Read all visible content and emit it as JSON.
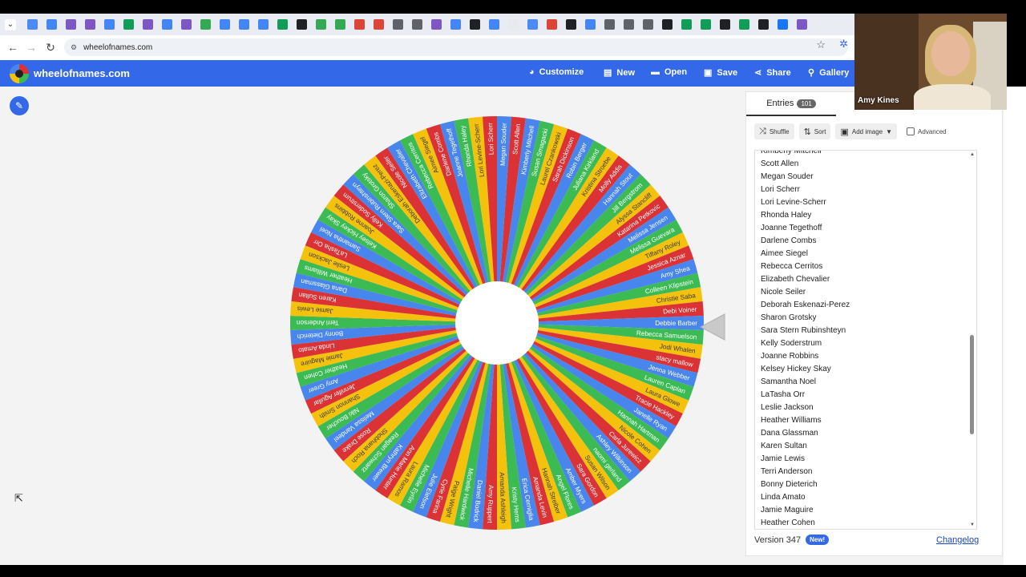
{
  "browser": {
    "url": "wheelofnames.com",
    "bookmark_colors": [
      "#4a8af4",
      "#4285f4",
      "#7e57c2",
      "#7e57c2",
      "#4285f4",
      "#0f9d58",
      "#7e57c2",
      "#4285f4",
      "#7e57c2",
      "#34a853",
      "#4285f4",
      "#4285f4",
      "#4285f4",
      "#0f9d58",
      "#202124",
      "#34a853",
      "#34a853",
      "#db4437",
      "#db4437",
      "#5f6368",
      "#5f6368",
      "#7e57c2",
      "#4285f4",
      "#202124",
      "#4285f4",
      "#e8eaed",
      "#4a8af4",
      "#db4437",
      "#202124",
      "#4285f4",
      "#5f6368",
      "#5f6368",
      "#5f6368",
      "#202124",
      "#0f9d58",
      "#0f9d58",
      "#202124",
      "#0f9d58",
      "#202124",
      "#1877f2",
      "#7e57c2"
    ]
  },
  "app": {
    "title": "wheelofnames.com",
    "menu": [
      {
        "label": "Customize",
        "icon": "palette-icon",
        "glyph": "◕"
      },
      {
        "label": "New",
        "icon": "new-file-icon",
        "glyph": "▤"
      },
      {
        "label": "Open",
        "icon": "folder-icon",
        "glyph": "▬"
      },
      {
        "label": "Save",
        "icon": "save-icon",
        "glyph": "▣"
      },
      {
        "label": "Share",
        "icon": "share-icon",
        "glyph": "⋖"
      },
      {
        "label": "Gallery",
        "icon": "search-icon",
        "glyph": "⚲"
      }
    ]
  },
  "colors": {
    "app_blue": "#3369e8",
    "wheel": [
      "#db3236",
      "#4885ed",
      "#3cba54",
      "#f4c20d"
    ]
  },
  "wheel": {
    "names": [
      "Scott Allen",
      "Kimberly Mitchell",
      "Susan Smagacki",
      "Laurel Czankowski",
      "Sarah Dickinson",
      "Robin Berger",
      "Juliana Kirkland",
      "Kristina Stroebe",
      "Molly Addis",
      "Hannah Stout",
      "Jill Bergstrom",
      "Alyssa Stancliff",
      "Katarina Petkovic",
      "Melissa Jensen",
      "Melissa Guevara",
      "Tiffany Roley",
      "Jessica Aznar",
      "Amy Shea",
      "Colleen Klipstein",
      "Christie Saba",
      "Debi Voiner",
      "Debbie Barber",
      "Rebecca Samuelson",
      "Jodi Whalen",
      "stacy mallow",
      "Jenna Webber",
      "Lauren Caplan",
      "Laura Glowe",
      "Tracie Hackley",
      "Janelle Ryan",
      "Hannah Hartman",
      "Nicole Cohen",
      "Carla Jurewicz",
      "Ashley Wilkinson",
      "naomi gerland",
      "Susan Wilson",
      "Sara Gordon",
      "Amber Myers",
      "Angel Flores",
      "Hannah Streiber",
      "Amanda Levin",
      "Erica Cerniglia",
      "Kristy Hems",
      "Amanda Ashleigh",
      "Amy Ruppert",
      "Daniel Bodrick",
      "Michelle Hardwick",
      "Paige Wright",
      "Cyrie Farina",
      "Julie Elefson",
      "Michelle Eyrlin",
      "Laura Ramos",
      "Ann Marie Hunter",
      "Kathryn Brewer",
      "Reagan Schwartz",
      "Shobhana Roch",
      "Rose Drake",
      "Melissa Vandeel",
      "Niki Boucher",
      "Shannon Smith",
      "Jennifer Aguilar",
      "Amy Greer",
      "Heather Cohen",
      "Jamie Maguire",
      "Linda Amato",
      "Bonny Dieterich",
      "Terri Anderson",
      "Jamie Lewis",
      "Karen Sultan",
      "Dana Glassman",
      "Heather Williams",
      "Leslie Jackson",
      "LaTasha Orr",
      "Samantha Noel",
      "Kelsey Hickey Skay",
      "Joanne Robbins",
      "Kelly Soderstrum",
      "Sara Stern Rubinshteyn",
      "Sharon Grotsky",
      "Deborah Eskenazi-Perez",
      "Nicole Seiler",
      "Elizabeth Chevalier",
      "Rebecca Cerritos",
      "Aimee Siegel",
      "Darlene Combs",
      "Joanne Tegethoff",
      "Rhonda Haley",
      "Lori Levine-Scherr",
      "Lori Scherr",
      "Megan Souder"
    ]
  },
  "entries": {
    "tab_label": "Entries",
    "count": "101",
    "toolbar": {
      "shuffle": "Shuffle",
      "sort": "Sort",
      "add_image": "Add image",
      "advanced": "Advanced"
    },
    "items": [
      "Kimberly Mitchell",
      "Scott Allen",
      "Megan Souder",
      "Lori Scherr",
      "Lori Levine-Scherr",
      "Rhonda Haley",
      "Joanne Tegethoff",
      "Darlene Combs",
      "Aimee Siegel",
      "Rebecca Cerritos",
      "Elizabeth Chevalier",
      "Nicole Seiler",
      "Deborah Eskenazi-Perez",
      "Sharon Grotsky",
      "Sara Stern Rubinshteyn",
      "Kelly Soderstrum",
      "Joanne Robbins",
      "Kelsey Hickey Skay",
      "Samantha Noel",
      "LaTasha Orr",
      "Leslie Jackson",
      "Heather Williams",
      "Dana Glassman",
      "Karen Sultan",
      "Jamie Lewis",
      "Terri Anderson",
      "Bonny Dieterich",
      "Linda Amato",
      "Jamie Maguire",
      "Heather Cohen"
    ],
    "version_label": "Version 347",
    "new_badge": "New!",
    "changelog": "Changelog"
  },
  "video": {
    "participant_name": "Amy Kines"
  }
}
